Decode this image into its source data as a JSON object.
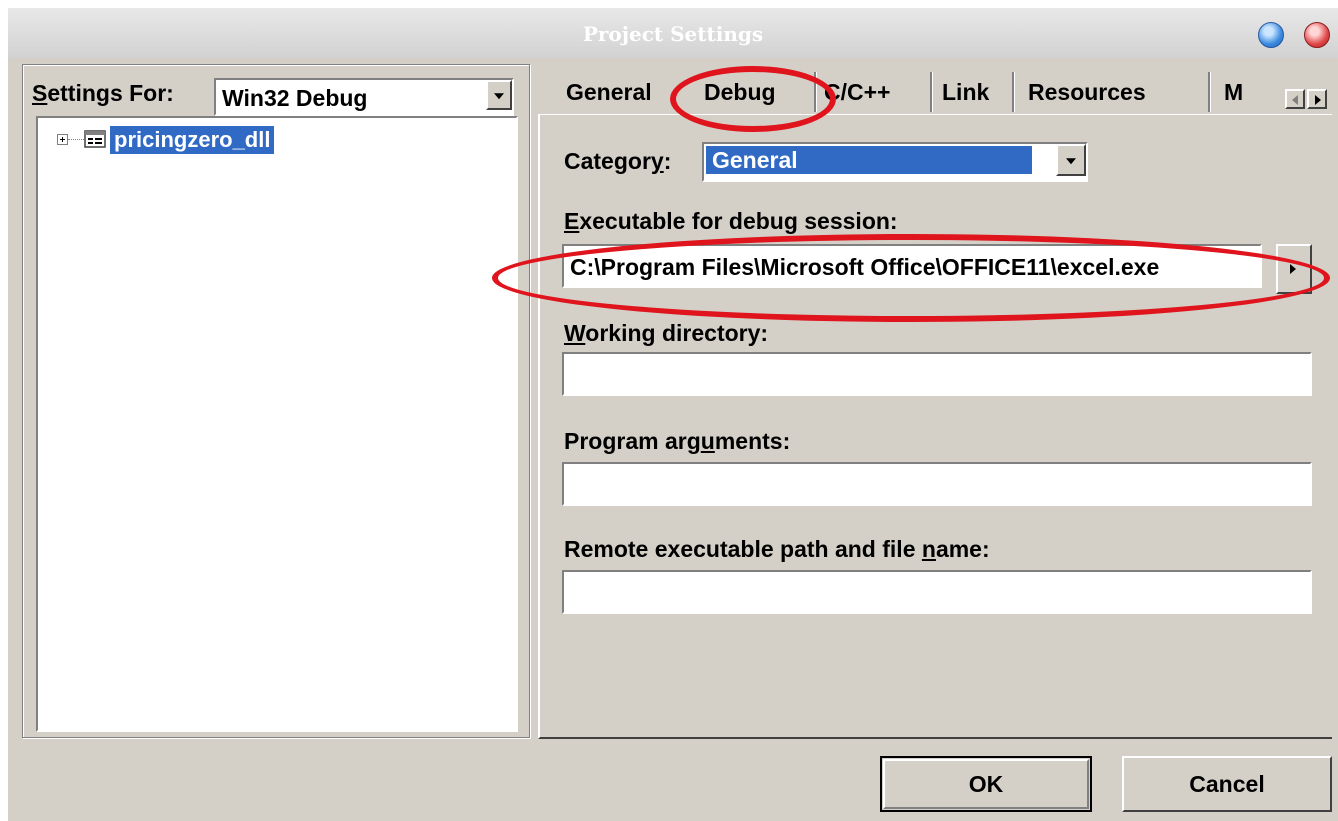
{
  "window": {
    "title": "Project Settings"
  },
  "left_panel": {
    "settings_for_label_first": "S",
    "settings_for_label_rest": "ettings For:",
    "configuration": "Win32 Debug",
    "tree": [
      {
        "label": "pricingzero_dll",
        "icon": "project-icon",
        "expanded": false,
        "selected": true
      }
    ]
  },
  "tabs": [
    {
      "label": "General"
    },
    {
      "label": "Debug",
      "active": true
    },
    {
      "label": "C/C++"
    },
    {
      "label": "Link"
    },
    {
      "label": "Resources"
    },
    {
      "label": "M"
    }
  ],
  "debug_page": {
    "category_label_pre": "Categor",
    "category_label_u": "y",
    "category_label_post": ":",
    "category_value": "General",
    "executable_label_u": "E",
    "executable_label_rest": "xecutable for debug session:",
    "executable_value": "C:\\Program Files\\Microsoft Office\\OFFICE11\\excel.exe",
    "working_dir_label_u": "W",
    "working_dir_label_rest": "orking directory:",
    "working_dir_value": "",
    "program_args_label_pre": "Program arg",
    "program_args_label_u": "u",
    "program_args_label_post": "ments:",
    "program_args_value": "",
    "remote_label_pre": "Remote executable path and file ",
    "remote_label_u": "n",
    "remote_label_post": "ame:",
    "remote_value": ""
  },
  "buttons": {
    "ok": "OK",
    "cancel": "Cancel"
  },
  "annotations": {
    "color": "#e0141c",
    "circled": [
      "Debug tab",
      "Executable for debug session field"
    ]
  },
  "colors": {
    "dialog_face": "#d4d0c8",
    "selection": "#316ac5"
  }
}
